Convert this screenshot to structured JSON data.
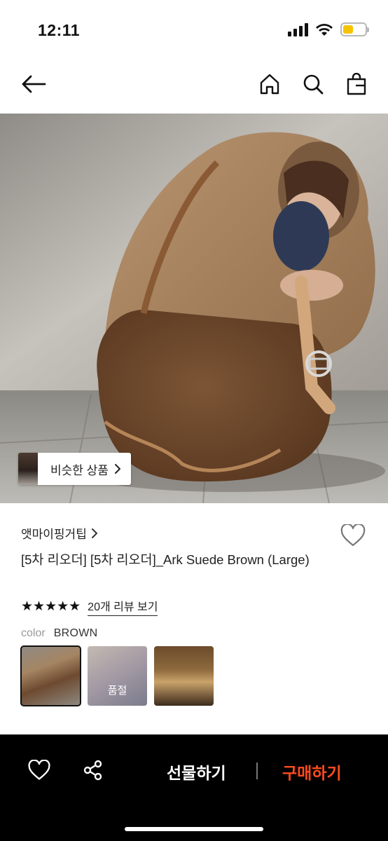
{
  "status_bar": {
    "time": "12:11"
  },
  "similar_chip": {
    "label": "비슷한 상품"
  },
  "product": {
    "brand": "앳마이핑거팁",
    "title": "[5차 리오더] [5차 리오더]_Ark Suede Brown (Large)",
    "rating_stars": "★★★★★",
    "review_link": "20개 리뷰 보기",
    "color_label": "color",
    "color_value": "BROWN",
    "soldout_label": "품절"
  },
  "bottom_bar": {
    "gift_label": "선물하기",
    "buy_label": "구매하기"
  },
  "colors": {
    "buy_accent": "#ff4b1f",
    "battery": "#f5c400"
  },
  "icons": [
    "signal-icon",
    "wifi-icon",
    "battery-icon",
    "back-arrow-icon",
    "home-icon",
    "search-icon",
    "shopping-bag-icon",
    "chevron-right-icon",
    "heart-icon",
    "share-icon"
  ]
}
